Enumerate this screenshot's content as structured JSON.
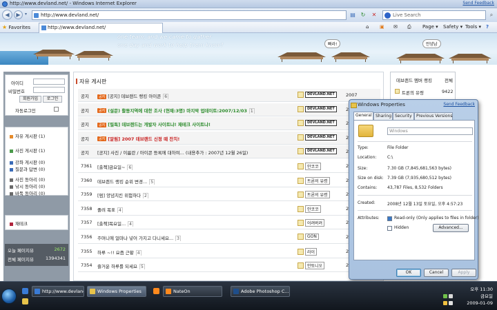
{
  "window": {
    "title": "http://www.devland.net/ - Windows Internet Explorer",
    "send_feedback": "Send Feedback"
  },
  "address": {
    "url": "http://www.devland.net/",
    "search_placeholder": "Live Search"
  },
  "favbar": {
    "favorites": "Favorites",
    "tab_title": "http://www.devland.net/",
    "page": "Page",
    "safety": "Safety",
    "tools": "Tools"
  },
  "banner": {
    "slogan_line1": "one team, and we came to gather",
    "slogan_line2": "one day and work to help them know?",
    "bubble1": "빠라!",
    "bubble2": "안녕남"
  },
  "login": {
    "id_label": "아이디",
    "pw_label": "비밀번호",
    "join": "회원가입",
    "login": "로그인",
    "auto": "자동로그인"
  },
  "menu": [
    {
      "label": "자유 게시판",
      "count": "(1)",
      "color": "#e58a2a"
    },
    {
      "label": "사진 게시판",
      "count": "(1)",
      "color": "#4a9a4a"
    },
    {
      "label": "강좌 게시판",
      "count": "(0)",
      "color": "#3a6bb8"
    },
    {
      "label": "질문과 답변",
      "count": "(0)",
      "color": "#3a6bb8"
    },
    {
      "label": "사진 동아리",
      "count": "(0)",
      "color": "#6a6a6a"
    },
    {
      "label": "낚시 동아리",
      "count": "(0)",
      "color": "#6a6a6a"
    },
    {
      "label": "바둑 동아리",
      "count": "(0)",
      "color": "#6a6a6a"
    }
  ],
  "jaeteuk": "재테크",
  "stats": {
    "today_label": "오늘 페이지뷰",
    "today_value": "2672",
    "total_label": "전체 페이지뷰",
    "total_value": "1394341"
  },
  "board": {
    "title": "자유 게시판",
    "rows": [
      {
        "no": "공지",
        "tag": "공지",
        "subject": "[공지] 데브랜드 랭킹 아이콘",
        "comments": "6",
        "user": "DEVLAND.NET",
        "date": "2007",
        "kind": "notice"
      },
      {
        "no": "공지",
        "tag": "공지",
        "subject": "(설문) 활동지역에 대한 조사 (현재:3명) 마지막 업데이트:2007/12/03",
        "comments": "1",
        "user": "DEVLAND.NET",
        "date": "2007",
        "kind": "notice-green"
      },
      {
        "no": "공지",
        "tag": "공지",
        "subject": "[필독] 데브랜드는 개발자 사이트냐! 재테크 사이트냐!",
        "comments": "",
        "user": "DEVLAND.NET",
        "date": "2007",
        "kind": "notice-green"
      },
      {
        "no": "공지",
        "tag": "공지",
        "subject": "[알림] 2007 데브랜드 신정 때 잔치!",
        "comments": "",
        "user": "DEVLAND.NET",
        "date": "2007",
        "kind": "notice-red"
      },
      {
        "no": "공지",
        "tag": "",
        "subject": "[공지] 사진 / 이름란 / 아이콘 등록에 대하여... (내용추가 : 2007년 12월 26일)",
        "comments": "",
        "user": "DEVLAND.NET",
        "date": "2007",
        "kind": "notice"
      },
      {
        "no": "7361",
        "tag": "",
        "subject": "[출첵]금요일~",
        "comments": "6",
        "user": "안코코",
        "date": "2009",
        "kind": "normal"
      },
      {
        "no": "7360",
        "tag": "",
        "subject": "데브랜드 랭킹 순위 변경...",
        "comments": "5",
        "user": "트론의 유령",
        "date": "2009",
        "kind": "normal"
      },
      {
        "no": "7359",
        "tag": "",
        "subject": "[펌] 양념치킨 위험하다",
        "comments": "2",
        "user": "트론의 유령",
        "date": "2009",
        "kind": "normal"
      },
      {
        "no": "7358",
        "tag": "",
        "subject": "졸려 목표",
        "comments": "4",
        "user": "안코코",
        "date": "2009",
        "kind": "normal"
      },
      {
        "no": "7357",
        "tag": "",
        "subject": "[출첵]목요일...",
        "comments": "4",
        "user": "어려버려",
        "date": "2009",
        "kind": "normal"
      },
      {
        "no": "7356",
        "tag": "",
        "subject": "주머니에 얼마나 넣어 가지고 다니세요...",
        "comments": "3",
        "user": "GON",
        "date": "2009",
        "kind": "normal"
      },
      {
        "no": "7355",
        "tag": "",
        "subject": "하루 ~!! 요즘 근황",
        "comments": "4",
        "user": "라이",
        "date": "2009",
        "kind": "normal"
      },
      {
        "no": "7354",
        "tag": "",
        "subject": "즐거운 하루를 되세요",
        "comments": "5",
        "user": "안토니오",
        "date": "2009",
        "kind": "normal"
      }
    ]
  },
  "ranking": {
    "header": "데브랜드 멤버 랭킹",
    "header_right": "전체",
    "first_name": "트론의 유령",
    "first_score": "9422"
  },
  "dialog": {
    "title": "Windows Properties",
    "send_feedback": "Send Feedback",
    "tabs": [
      "General",
      "Sharing",
      "Security",
      "Previous Versions"
    ],
    "name": "Windows",
    "type_label": "Type:",
    "type_value": "File Folder",
    "location_label": "Location:",
    "location_value": "C:\\",
    "size_label": "Size:",
    "size_value": "7.30 GB (7,845,681,563 bytes)",
    "disk_label": "Size on disk:",
    "disk_value": "7.39 GB (7,935,680,512 bytes)",
    "contains_label": "Contains:",
    "contains_value": "43,787 Files, 8,532 Folders",
    "created_label": "Created:",
    "created_value": "2008년 12월 13일 토요일, 오후 4:57:23",
    "attrs_label": "Attributes:",
    "readonly": "Read-only (Only applies to files in folder)",
    "hidden": "Hidden",
    "advanced": "Advanced...",
    "ok": "OK",
    "cancel": "Cancel",
    "apply": "Apply"
  },
  "taskbar": {
    "items": [
      {
        "label": "http://www.devland.ne...",
        "color": "#3a7bd5"
      },
      {
        "label": "Windows Properties",
        "color": "#e7c34a"
      },
      {
        "label": "NateOn",
        "color": "#ff8a1e"
      },
      {
        "label": "Adobe Photoshop C...",
        "color": "#1f4e8a"
      }
    ],
    "time": "오후 11:30",
    "day": "금요일",
    "date": "2009-01-09"
  }
}
